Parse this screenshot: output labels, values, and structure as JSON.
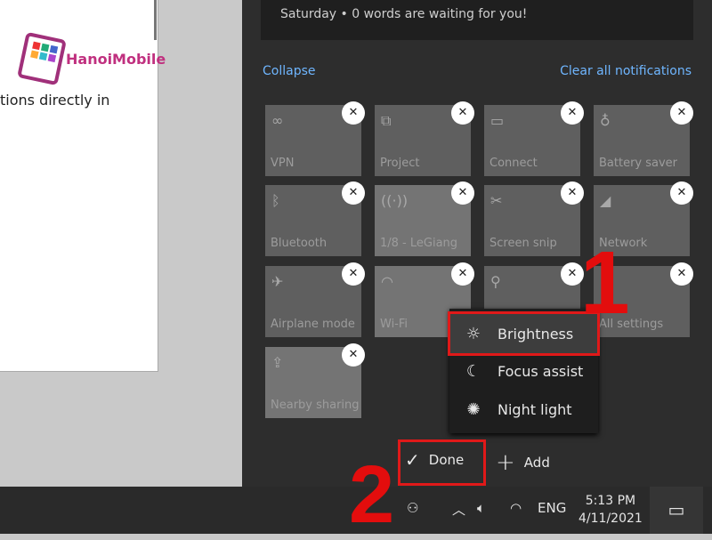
{
  "window": {
    "text": "tions directly in"
  },
  "watermark": {
    "text": "HanoiMobile"
  },
  "action_center": {
    "notification": "Saturday • 0 words are waiting for you!",
    "collapse": "Collapse",
    "clear_all": "Clear all notifications",
    "tiles": [
      {
        "label": "VPN",
        "icon": "vpn-icon",
        "glyph": "∞",
        "active": false
      },
      {
        "label": "Project",
        "icon": "project-icon",
        "glyph": "⧉",
        "active": false
      },
      {
        "label": "Connect",
        "icon": "connect-icon",
        "glyph": "▭",
        "active": false
      },
      {
        "label": "Battery saver",
        "icon": "battery-saver-icon",
        "glyph": "♁",
        "active": false
      },
      {
        "label": "Bluetooth",
        "icon": "bluetooth-icon",
        "glyph": "ᛒ",
        "active": false
      },
      {
        "label": "1/8 - LeGiang",
        "icon": "hotspot-icon",
        "glyph": "((·))",
        "active": true
      },
      {
        "label": "Screen snip",
        "icon": "screen-snip-icon",
        "glyph": "✂",
        "active": false
      },
      {
        "label": "Network",
        "icon": "network-icon",
        "glyph": "◢",
        "active": false
      },
      {
        "label": "Airplane mode",
        "icon": "airplane-icon",
        "glyph": "✈",
        "active": false
      },
      {
        "label": "Wi-Fi",
        "icon": "wifi-icon",
        "glyph": "◠",
        "active": true
      },
      {
        "label": "",
        "icon": "location-icon",
        "glyph": "⚲",
        "active": false
      },
      {
        "label": "All settings",
        "icon": "settings-icon",
        "glyph": "⚙",
        "active": false
      },
      {
        "label": "Nearby sharing",
        "icon": "nearby-sharing-icon",
        "glyph": "⇪",
        "active": true
      }
    ],
    "unpin_glyph": "✕",
    "add_menu": [
      {
        "label": "Brightness",
        "icon": "brightness-icon",
        "glyph": "☼"
      },
      {
        "label": "Focus assist",
        "icon": "moon-icon",
        "glyph": "☾"
      },
      {
        "label": "Night light",
        "icon": "night-light-icon",
        "glyph": "✺"
      }
    ],
    "done": "Done",
    "add": "Add"
  },
  "annotations": {
    "step1": "1",
    "step2": "2",
    "color": "#e30d0d"
  },
  "taskbar": {
    "lang": "ENG",
    "time": "5:13 PM",
    "date": "4/11/2021"
  }
}
